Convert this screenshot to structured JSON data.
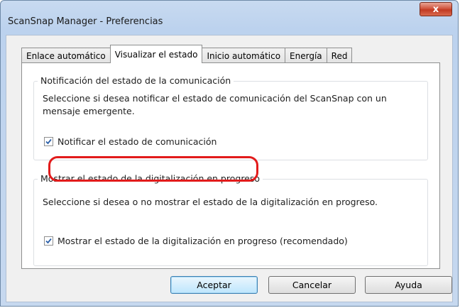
{
  "window": {
    "title": "ScanSnap Manager - Preferencias",
    "close_label": "x"
  },
  "tabs": [
    {
      "label": "Enlace automático",
      "active": false
    },
    {
      "label": "Visualizar el estado",
      "active": true
    },
    {
      "label": "Inicio automático",
      "active": false
    },
    {
      "label": "Energía",
      "active": false
    },
    {
      "label": "Red",
      "active": false
    }
  ],
  "notification_group": {
    "legend": "Notificación del estado de la comunicación",
    "description_line1": "Seleccione si desea notificar el estado de comunicación del ScanSnap con un",
    "description_line2": "mensaje emergente.",
    "checkbox_label": "Notificar el estado de comunicación",
    "checked": true
  },
  "progress_group": {
    "legend": "Mostrar el estado de la digitalización en progreso",
    "description": "Seleccione si desea o no mostrar el estado de la digitalización en progreso.",
    "checkbox_label": "Mostrar el estado de la digitalización en progreso (recomendado)",
    "checked": true
  },
  "buttons": {
    "ok": "Aceptar",
    "cancel": "Cancelar",
    "help": "Ayuda"
  },
  "colors": {
    "highlight": "#e21b1b",
    "check": "#2a5fa8"
  }
}
